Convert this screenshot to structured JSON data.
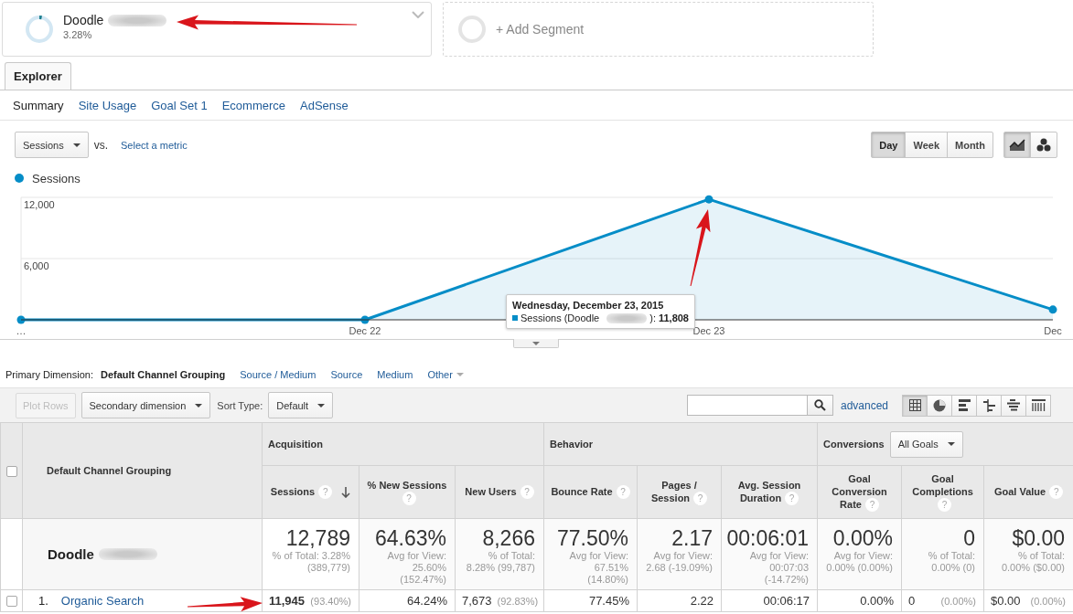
{
  "segments": [
    {
      "kind": "segment",
      "name": "Doodle",
      "percent": "3.28%",
      "level": 0.0328
    },
    {
      "kind": "add",
      "label": "+ Add Segment"
    }
  ],
  "tabs": [
    {
      "label": "Explorer",
      "selected": true
    }
  ],
  "subtabs": [
    {
      "label": "Summary",
      "selected": true
    },
    {
      "label": "Site Usage",
      "selected": false
    },
    {
      "label": "Goal Set 1",
      "selected": false
    },
    {
      "label": "Ecommerce",
      "selected": false
    },
    {
      "label": "AdSense",
      "selected": false
    }
  ],
  "metric_bar": {
    "metric": "Sessions",
    "vs_label": "vs.",
    "compare_link": "Select a metric"
  },
  "period_buttons": [
    {
      "label": "Day",
      "selected": true
    },
    {
      "label": "Week",
      "selected": false
    },
    {
      "label": "Month",
      "selected": false
    }
  ],
  "chart_type_buttons": [
    {
      "kind": "line",
      "selected": true
    },
    {
      "kind": "motion",
      "selected": false
    }
  ],
  "chart": {
    "chart_data": {
      "type": "area",
      "categories": [
        "…",
        "Dec 22",
        "Dec 23",
        "Dec"
      ],
      "series": [
        {
          "name": "Sessions",
          "color": "#058dc7",
          "values": [
            0,
            0,
            11808,
            1000
          ]
        }
      ],
      "ylim": [
        0,
        12000
      ],
      "yticks": [
        {
          "value": 6000,
          "label": "6,000"
        },
        {
          "value": 12000,
          "label": "12,000"
        }
      ]
    },
    "tooltip": {
      "title": "Wednesday, December 23, 2015",
      "label_start": "Sessions (Doodle",
      "label_end": "):",
      "value": "11,808"
    }
  },
  "primary_dimension": {
    "label": "Primary Dimension:",
    "options": [
      {
        "label": "Default Channel Grouping",
        "kind": "link",
        "selected": true
      },
      {
        "label": "Source / Medium",
        "kind": "link",
        "selected": false
      },
      {
        "label": "Source",
        "kind": "link",
        "selected": false
      },
      {
        "label": "Medium",
        "kind": "link",
        "selected": false
      },
      {
        "label": "Other",
        "kind": "menu",
        "selected": false
      }
    ]
  },
  "toolbar": {
    "plot_rows": {
      "label": "Plot Rows",
      "disabled": true
    },
    "secondary_dimension": "Secondary dimension",
    "sort_type_label": "Sort Type:",
    "sort_type": "Default",
    "advanced_link": "advanced",
    "views": [
      {
        "kind": "table",
        "selected": true
      },
      {
        "kind": "pie",
        "selected": false
      },
      {
        "kind": "bars",
        "selected": false
      },
      {
        "kind": "comparison",
        "selected": false
      },
      {
        "kind": "cloud",
        "selected": false
      },
      {
        "kind": "pivot",
        "selected": false
      }
    ]
  },
  "table": {
    "select_all": {
      "checked": false
    },
    "dimension_header": "Default Channel Grouping",
    "groups": [
      {
        "label": "Acquisition",
        "columns": [
          {
            "label": "Sessions",
            "help": "?",
            "sorted": true
          },
          {
            "label": "% New Sessions",
            "help": "?",
            "sorted": false
          },
          {
            "label": "New Users",
            "help": "?",
            "sorted": false
          }
        ]
      },
      {
        "label": "Behavior",
        "columns": [
          {
            "label": "Bounce Rate",
            "help": "?",
            "sorted": false
          },
          {
            "label": "Pages / Session",
            "help": "?",
            "sorted": false
          },
          {
            "label": "Avg. Session Duration",
            "help": "?",
            "sorted": false
          }
        ]
      },
      {
        "label": "Conversions",
        "dropdown": "All Goals",
        "columns": [
          {
            "label": "Goal Conversion Rate",
            "help": "?",
            "sorted": false
          },
          {
            "label": "Goal Completions",
            "help": "?",
            "sorted": false
          },
          {
            "label": "Goal Value",
            "help": "?",
            "sorted": false
          }
        ]
      }
    ],
    "totals": {
      "name": "Doodle",
      "cells": [
        {
          "value": "12,789",
          "note": "% of Total: 3.28%\n(389,779)"
        },
        {
          "value": "64.63%",
          "note": "Avg for View:\n25.60%\n(152.47%)"
        },
        {
          "value": "8,266",
          "note": "% of Total:\n8.28% (99,787)"
        },
        {
          "value": "77.50%",
          "note": "Avg for View:\n67.51%\n(14.80%)"
        },
        {
          "value": "2.17",
          "note": "Avg for View:\n2.68 (-19.09%)"
        },
        {
          "value": "00:06:01",
          "note": "Avg for View:\n00:07:03\n(-14.72%)"
        },
        {
          "value": "0.00%",
          "note": "Avg for View:\n0.00% (0.00%)"
        },
        {
          "value": "0",
          "note": "% of Total:\n0.00% (0)"
        },
        {
          "value": "$0.00",
          "note": "% of Total:\n0.00% ($0.00)"
        }
      ]
    },
    "rows": [
      {
        "index": "1.",
        "name": "Organic Search",
        "checked": false,
        "cells": [
          {
            "value": "11,945",
            "share": "(93.40%)"
          },
          {
            "value": "64.24%"
          },
          {
            "value": "7,673",
            "share": "(92.83%)"
          },
          {
            "value": "77.45%"
          },
          {
            "value": "2.22"
          },
          {
            "value": "00:06:17"
          },
          {
            "value": "0.00%"
          },
          {
            "value": "0",
            "share": "(0.00%)"
          },
          {
            "value": "$0.00",
            "share": "(0.00%)"
          }
        ]
      }
    ]
  }
}
